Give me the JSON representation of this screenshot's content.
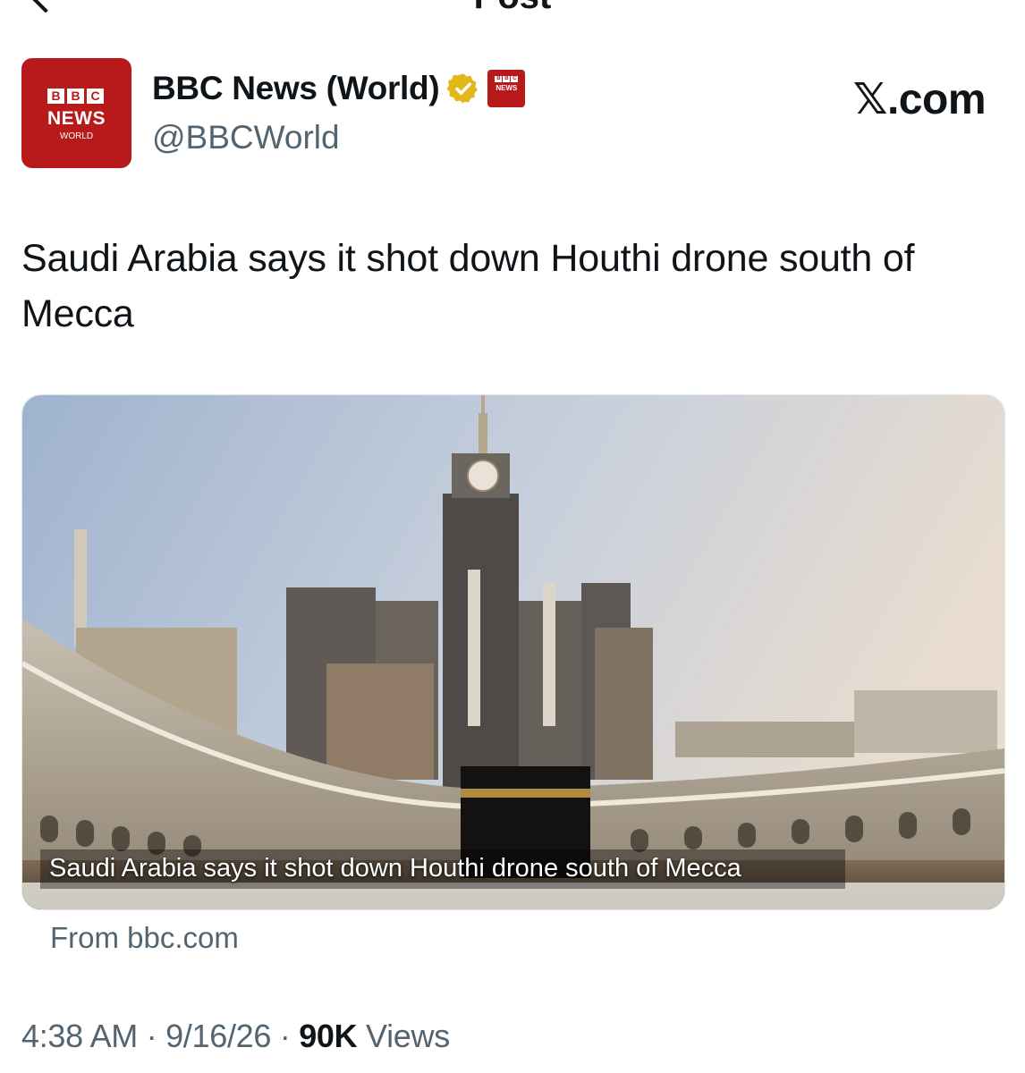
{
  "header": {
    "title": "Post"
  },
  "author": {
    "avatar": {
      "bbc_letters": [
        "B",
        "B",
        "C"
      ],
      "news": "NEWS",
      "region": "WORLD"
    },
    "display_name": "BBC News (World)",
    "handle": "@BBCWorld",
    "verified_icon": "gold-verified-badge-icon",
    "affiliate_badge": {
      "bbc_letters": [
        "B",
        "B",
        "C"
      ],
      "news": "NEWS"
    }
  },
  "platform_logo": "𝕏.com",
  "tweet": {
    "text": "Saudi Arabia says it shot down Houthi drone south of Mecca",
    "card": {
      "image": "Mecca clock tower and Kaaba photo",
      "caption": "Saudi Arabia says it shot down Houthi drone south of Mecca",
      "source": "From bbc.com"
    }
  },
  "meta": {
    "time": "4:38 AM",
    "sep1": " · ",
    "date": "9/16/26",
    "sep2": " · ",
    "views_count": "90K",
    "views_label": " Views"
  },
  "colors": {
    "bbc_red": "#b8191b",
    "text": "#0f1419",
    "muted": "#536471",
    "verified_gold": "#e2b719"
  }
}
